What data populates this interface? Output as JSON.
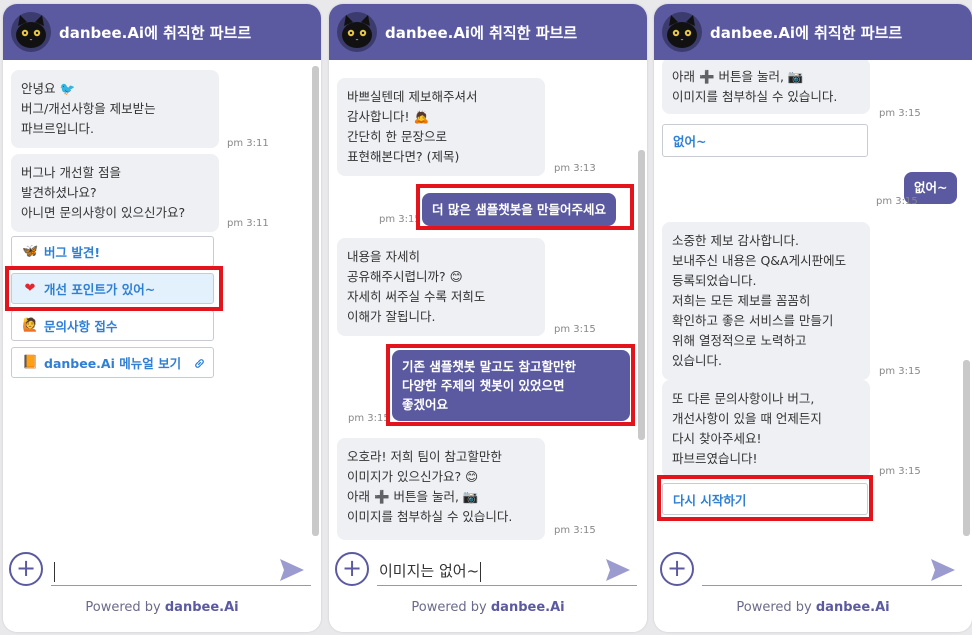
{
  "app": {
    "title": "danbee.Ai에 취직한 파브르",
    "powered_prefix": "Powered by ",
    "powered_brand": "danbee.Ai",
    "colors": {
      "brand": "#5b5aa0",
      "link": "#2f7fd5",
      "highlight": "#e3141c",
      "bubble": "#eef0f4"
    }
  },
  "panel1": {
    "bubble1": "안녕요 🐦\n버그/개선사항을 제보받는\n파브르입니다.",
    "time1": "pm 3:11",
    "bubble2": "버그나 개선할 점을\n발견하셨나요?\n아니면 문의사항이 있으신가요?",
    "time2": "pm 3:11",
    "buttons": [
      {
        "icon": "🦋",
        "icon_name": "butterfly-icon",
        "label": "버그 발견!"
      },
      {
        "icon": "❤",
        "icon_name": "heart-icon",
        "label": "개선 포인트가 있어~"
      },
      {
        "icon": "🙋",
        "icon_name": "person-raising-hand-icon",
        "label": "문의사항 접수"
      },
      {
        "icon": "📙",
        "icon_name": "book-icon",
        "label": "danbee.Ai 메뉴얼 보기"
      }
    ],
    "input_value": ""
  },
  "panel2": {
    "bubble1": "바쁘실텐데 제보해주셔서\n감사합니다! 🙇\n간단히 한 문장으로\n표현해본다면? (제목)",
    "time1": "pm 3:13",
    "user1": "더 많은 샘플챗봇을 만들어주세요",
    "time_user1": "pm 3:15",
    "bubble2": "내용을 자세히\n공유해주시렵니까? 😊\n자세히 써주실 수록 저희도\n이해가 잘됩니다.",
    "time2": "pm 3:15",
    "user2": "기존 샘플챗봇 말고도 참고할만한\n다양한 주제의 챗봇이 있었으면\n좋겠어요",
    "time_user2": "pm 3:15",
    "bubble3": "오호라! 저희 팀이 참고할만한\n이미지가 있으신가요? 😊\n아래 ➕ 버튼을 눌러, 📷\n이미지를 첨부하실 수 있습니다.",
    "time3": "pm 3:15",
    "input_value": "이미지는 없어~"
  },
  "panel3": {
    "bubble_top": "아래 ➕ 버튼을 눌러, 📷\n이미지를 첨부하실 수 있습니다.",
    "time_top": "pm 3:15",
    "reply_button": "없어~",
    "user1": "없어~",
    "time_user1": "pm 3:15",
    "bubble2": "소중한 제보 감사합니다.\n보내주신 내용은 Q&A게시판에도\n등록되었습니다.\n저희는 모든 제보를 꼼꼼히\n확인하고 좋은 서비스를 만들기\n위해 열정적으로 노력하고\n있습니다.",
    "time2": "pm 3:15",
    "bubble3": "또 다른 문의사항이나 버그,\n개선사항이 있을 때 언제든지\n다시 찾아주세요!\n파브르였습니다!",
    "time3": "pm 3:15",
    "restart_button": "다시 시작하기",
    "input_value": ""
  }
}
